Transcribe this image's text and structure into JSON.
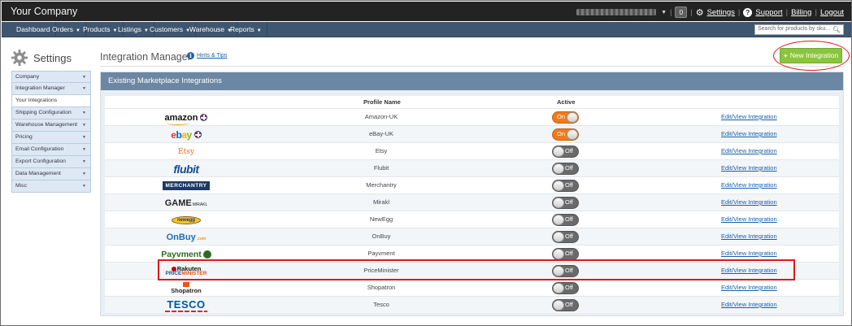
{
  "topbar": {
    "brand": "Your Company",
    "badge": "0",
    "sep": "|",
    "settings": "Settings",
    "support": "Support",
    "billing": "Billing",
    "logout": "Logout"
  },
  "nav": {
    "items": [
      "Dashboard",
      "Orders",
      "Products",
      "Listings",
      "Customers",
      "Warehouse",
      "Reports"
    ],
    "search_placeholder": "Search for products by sku..."
  },
  "sidebar": {
    "title": "Settings",
    "items": [
      "Company",
      "Integration Manager",
      "Your Integrations",
      "Shipping Configuration",
      "Warehouse Management",
      "Pricing",
      "Email Configuration",
      "Export Configuration",
      "Data Management",
      "Misc"
    ]
  },
  "main": {
    "title": "Integration Manager",
    "hints": "Hints & Tips",
    "new_button": "New Integration",
    "panel_title": "Existing Marketplace Integrations",
    "col_profile": "Profile Name",
    "col_active": "Active",
    "edit_label": "Edit/View Integration",
    "on_label": "On",
    "off_label": "Off",
    "rows": [
      {
        "name": "Amazon-UK",
        "logo_text": "amazon",
        "active": true
      },
      {
        "name": "eBay-UK",
        "logo_text": "ebay",
        "active": true
      },
      {
        "name": "Etsy",
        "logo_text": "Etsy",
        "active": false
      },
      {
        "name": "Flubit",
        "logo_text": "flubit",
        "active": false
      },
      {
        "name": "Merchantry",
        "logo_text": "MERCHANTRY",
        "active": false
      },
      {
        "name": "Mirakl",
        "logo_text": "GAME",
        "logo_sub": "MIRAKL",
        "active": false
      },
      {
        "name": "NewEgg",
        "logo_text": "newegg",
        "active": false
      },
      {
        "name": "OnBuy",
        "logo_text": "OnBuy",
        "logo_sub": ".com",
        "active": false
      },
      {
        "name": "Payvment",
        "logo_text": "Payvment",
        "active": false
      },
      {
        "name": "PriceMinister",
        "logo_text": "Rakuten",
        "logo_sub1": "PRICE",
        "logo_sub2": "MINISTER",
        "active": false
      },
      {
        "name": "Shopatron",
        "logo_text": "Shopatron",
        "active": false
      },
      {
        "name": "Tesco",
        "logo_text": "TESCO",
        "active": false
      }
    ]
  },
  "colors": {
    "topbar": "#232323",
    "navbar": "#3e5670",
    "panel_header": "#6c87a3",
    "new_button": "#8bc43f",
    "toggle_on": "#f07b1c",
    "annotation": "#e01616"
  }
}
